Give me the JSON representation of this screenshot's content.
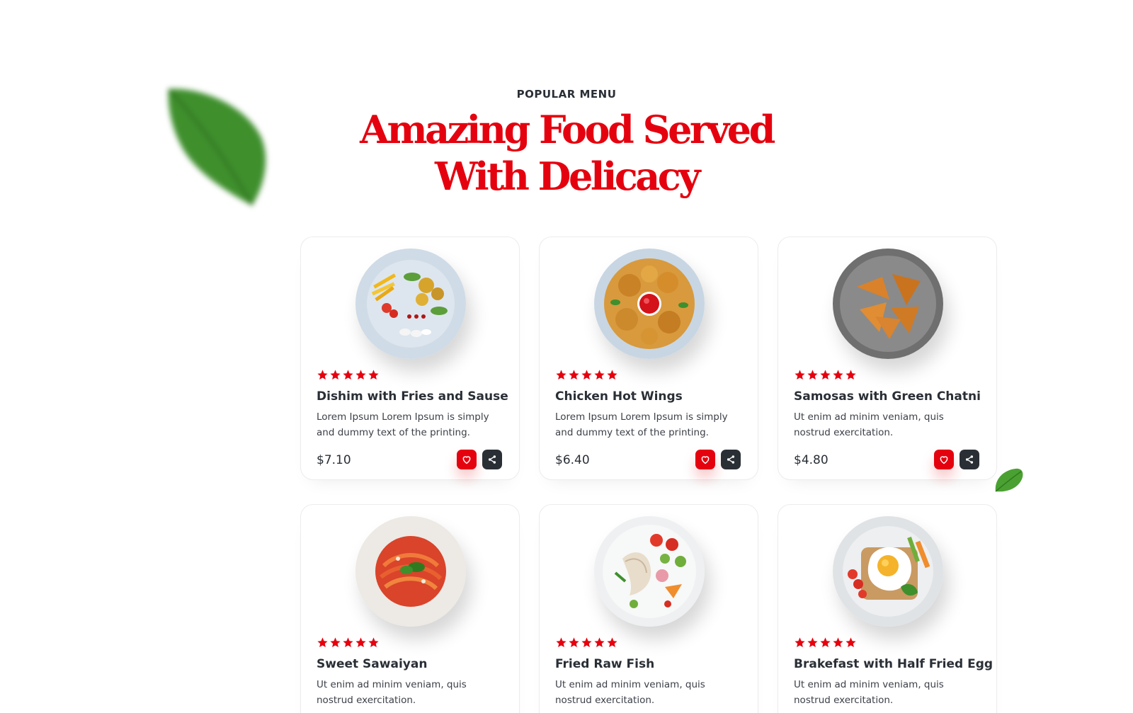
{
  "section": {
    "eyebrow": "POPULAR MENU",
    "headline_line1": "Amazing Food Served",
    "headline_line2": "With Delicacy"
  },
  "colors": {
    "accent": "#e5020f",
    "dark": "#2a2f36",
    "star": "#e5020f"
  },
  "menu_items": [
    {
      "title": "Dishim with Fries and Sause",
      "description": "Lorem Ipsum Lorem Ipsum is simply and dummy text of the printing.",
      "price": "$7.10",
      "rating": 5,
      "plate": "light-blue",
      "favorite_icon": "heart-icon",
      "share_icon": "share-icon"
    },
    {
      "title": "Chicken Hot Wings",
      "description": "Lorem Ipsum Lorem Ipsum is simply and dummy text of the printing.",
      "price": "$6.40",
      "rating": 5,
      "plate": "light-blue",
      "favorite_icon": "heart-icon",
      "share_icon": "share-icon"
    },
    {
      "title": "Samosas with Green Chatni",
      "description": "Ut enim ad minim veniam, quis nostrud exercitation.",
      "price": "$4.80",
      "rating": 5,
      "plate": "grey",
      "favorite_icon": "heart-icon",
      "share_icon": "share-icon"
    },
    {
      "title": "Sweet Sawaiyan",
      "description": "Ut enim ad minim veniam, quis nostrud exercitation.",
      "price": "",
      "rating": 5,
      "plate": "white",
      "favorite_icon": "heart-icon",
      "share_icon": "share-icon"
    },
    {
      "title": "Fried Raw Fish",
      "description": "Ut enim ad minim veniam, quis nostrud exercitation.",
      "price": "",
      "rating": 5,
      "plate": "white",
      "favorite_icon": "heart-icon",
      "share_icon": "share-icon"
    },
    {
      "title": "Brakefast with Half Fried Egg",
      "description": "Ut enim ad minim veniam, quis nostrud exercitation.",
      "price": "",
      "rating": 5,
      "plate": "light-grey",
      "favorite_icon": "heart-icon",
      "share_icon": "share-icon"
    }
  ]
}
